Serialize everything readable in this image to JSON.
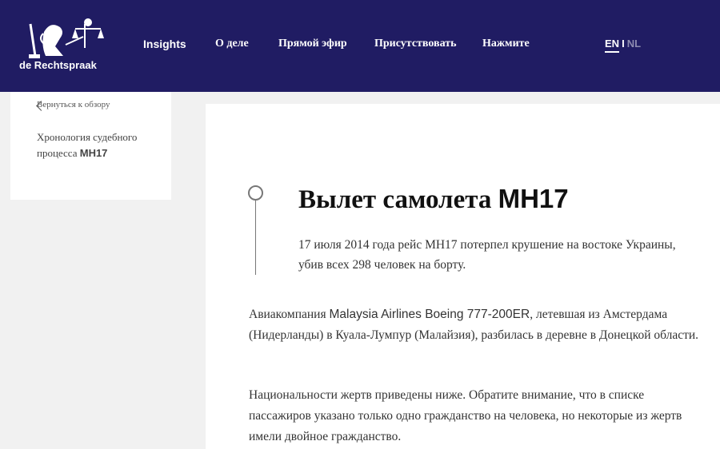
{
  "header": {
    "logo_text": "de Rechtspraak",
    "nav": [
      "Insights",
      "О деле",
      "Прямой эфир",
      "Присутствовать",
      "Нажмите"
    ],
    "lang_en": "EN",
    "lang_sep": "I",
    "lang_nl": "NL"
  },
  "sidebar": {
    "back_label": "Вернуться к обзору",
    "title_prefix": "Хронология судебного процесса",
    "title_bold": "MH17"
  },
  "article": {
    "title_prefix": "Вылет самолета",
    "title_bold": "MH17",
    "subtitle": "17 июля 2014 года рейс MH17 потерпел крушение на востоке Украины, убив всех 298 человек на борту.",
    "p1_a": "Авиакомпания ",
    "p1_b": "Malaysia Airlines Boeing 777-200ER",
    "p1_c": ", летевшая из Амстердама (Нидерланды) в Куала-Лумпур (Малайзия), разбилась в деревне в Донецкой области.",
    "p2": "Национальности жертв приведены ниже. Обратите внимание, что в списке пассажиров указано только одно гражданство на человека, но некоторые из жертв имели двойное гражданство."
  },
  "colors": {
    "header_bg": "#201c63",
    "page_bg": "#f1f1f1",
    "inactive_lang": "#8d8bb0"
  }
}
